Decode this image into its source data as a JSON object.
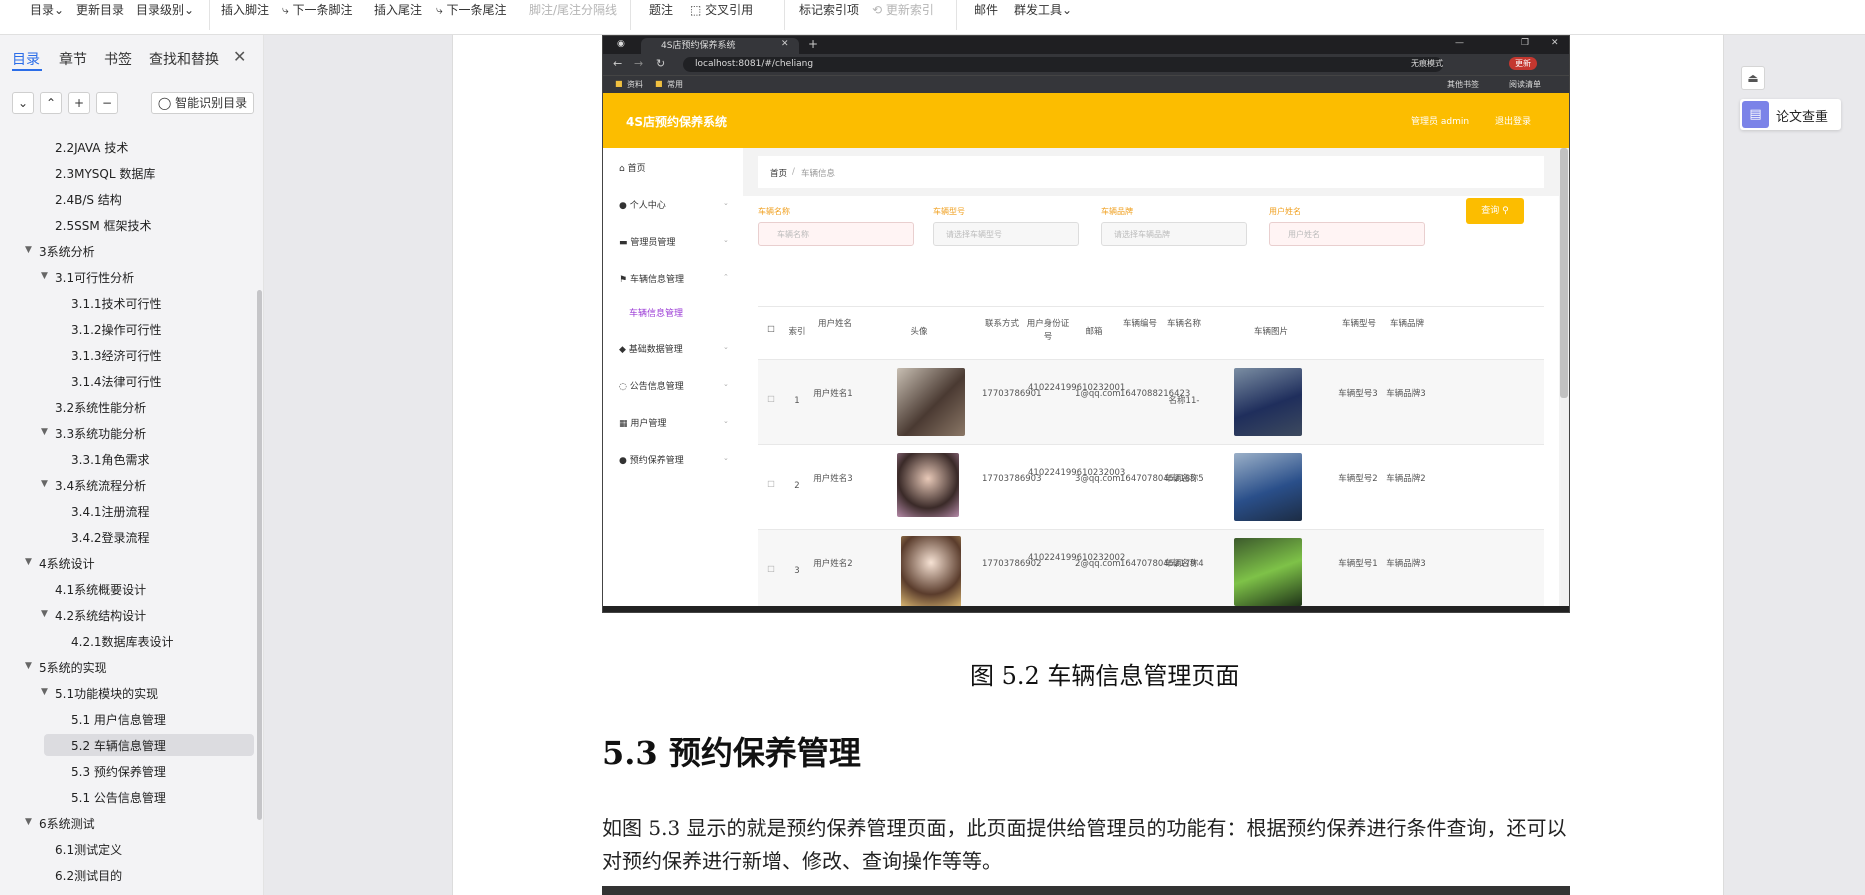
{
  "ribbon": {
    "toc": "目录",
    "update_toc": "更新目录",
    "toc_level": "目录级别",
    "insert_footnote": "插入脚注",
    "next_footnote": "下一条脚注",
    "insert_endnote": "插入尾注",
    "next_endnote": "下一条尾注",
    "separator_line": "脚注/尾注分隔线",
    "caption": "题注",
    "cross_ref": "交叉引用",
    "mark_index": "标记索引项",
    "update_index": "更新索引",
    "mail": "邮件",
    "mass_tools": "群发工具"
  },
  "nav": {
    "tabs": [
      "目录",
      "章节",
      "书签",
      "查找和替换"
    ],
    "smart_button": "智能识别目录",
    "items": [
      {
        "label": "2.2JAVA 技术"
      },
      {
        "label": "2.3MYSQL 数据库"
      },
      {
        "label": "2.4B/S 结构"
      },
      {
        "label": "2.5SSM 框架技术"
      },
      {
        "label": "3系统分析"
      },
      {
        "label": "3.1可行性分析"
      },
      {
        "label": "3.1.1技术可行性"
      },
      {
        "label": "3.1.2操作可行性"
      },
      {
        "label": "3.1.3经济可行性"
      },
      {
        "label": "3.1.4法律可行性"
      },
      {
        "label": "3.2系统性能分析"
      },
      {
        "label": "3.3系统功能分析"
      },
      {
        "label": "3.3.1角色需求"
      },
      {
        "label": "3.4系统流程分析"
      },
      {
        "label": "3.4.1注册流程"
      },
      {
        "label": "3.4.2登录流程"
      },
      {
        "label": "4系统设计"
      },
      {
        "label": "4.1系统概要设计"
      },
      {
        "label": "4.2系统结构设计"
      },
      {
        "label": "4.2.1数据库表设计"
      },
      {
        "label": "5系统的实现"
      },
      {
        "label": "5.1功能模块的实现"
      },
      {
        "label": "5.1 用户信息管理"
      },
      {
        "label": "5.2  车辆信息管理"
      },
      {
        "label": "5.3 预约保养管理"
      },
      {
        "label": "5.1 公告信息管理"
      },
      {
        "label": "6系统测试"
      },
      {
        "label": "6.1测试定义"
      },
      {
        "label": "6.2测试目的"
      }
    ]
  },
  "document": {
    "caption": "图 5.2  车辆信息管理页面",
    "heading": "5.3 预约保养管理",
    "paragraph": "如图 5.3 显示的就是预约保养管理页面，此页面提供给管理员的功能有：根据预约保养进行条件查询，还可以对预约保养进行新增、修改、查询操作等等。"
  },
  "screenshot": {
    "tab_title": "4S店预约保养系统",
    "url": "localhost:8081/#/cheliang",
    "bookmarks": [
      "资料",
      "常用"
    ],
    "bookmarks_right": [
      "其他书签",
      "阅读清单"
    ],
    "incognito": "无痕模式",
    "update": "更新",
    "app_title": "4S店预约保养系统",
    "admin": "管理员 admin",
    "logout": "退出登录",
    "menu": [
      "首页",
      "个人中心",
      "管理员管理",
      "车辆信息管理",
      "车辆信息管理",
      "基础数据管理",
      "公告信息管理",
      "用户管理",
      "预约保养管理"
    ],
    "breadcrumb_home": "首页",
    "breadcrumb_sep": "/",
    "breadcrumb_current": "车辆信息",
    "filters": {
      "name_label": "车辆名称",
      "name_ph": "车辆名称",
      "type_label": "车辆型号",
      "type_ph": "请选择车辆型号",
      "brand_label": "车辆品牌",
      "brand_ph": "请选择车辆品牌",
      "user_label": "用户姓名",
      "user_ph": "用户姓名",
      "query": "查询"
    },
    "columns": [
      "索引",
      "用户姓名",
      "头像",
      "联系方式",
      "用户身份证号",
      "邮箱",
      "车辆编号",
      "车辆名称",
      "车辆图片",
      "车辆型号",
      "车辆品牌"
    ],
    "rows": [
      {
        "idx": "1",
        "user": "用户姓名1",
        "phone": "17703786901",
        "idcard": "410224199610232001",
        "email": "1@qq.com",
        "code": "1647088216423",
        "name": "名称11-",
        "type": "车辆型号3",
        "brand": "车辆品牌3"
      },
      {
        "idx": "2",
        "user": "用户姓名3",
        "phone": "17703786903",
        "idcard": "410224199610232003",
        "email": "3@qq.com",
        "code": "16470780452185",
        "name": "车辆名称5",
        "type": "车辆型号2",
        "brand": "车辆品牌2"
      },
      {
        "idx": "3",
        "user": "用户姓名2",
        "phone": "17703786902",
        "idcard": "410224199610232002",
        "email": "2@qq.com",
        "code": "16470780452179",
        "name": "车辆名称4",
        "type": "车辆型号1",
        "brand": "车辆品牌3"
      }
    ]
  },
  "right_panel": {
    "paper_check": "论文查重"
  },
  "colors": {
    "accent": "#2b6de8",
    "app_header": "#fcbd00",
    "menu_active": "#9b3bd6"
  }
}
